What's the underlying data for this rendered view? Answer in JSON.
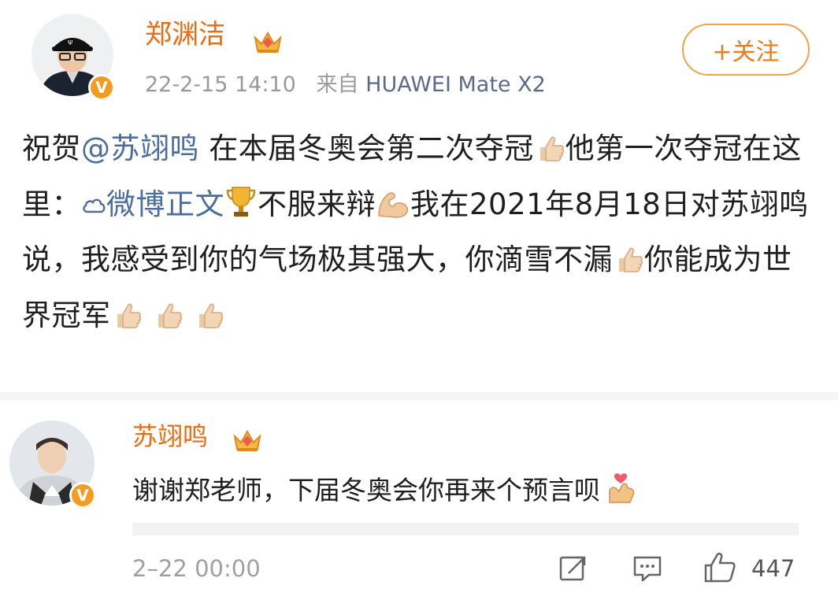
{
  "post": {
    "author": "郑渊洁",
    "timestamp": "22-2-15 14:10",
    "source_prefix": "来自",
    "device": "HUAWEI Mate X2",
    "follow_label": "+关注",
    "text_before_mention": "祝贺",
    "mention": "@苏翊鸣",
    "text_after_mention": " 在本届冬奥会第二次夺冠",
    "text_after_thumb1": "他第一次夺冠在这里：",
    "link_label": "微博正文",
    "text_after_trophy": "不服来辩",
    "text_after_muscle": "我在2021年8月18日对苏翊鸣说，我感受到你的气场极其强大，你滴雪不漏",
    "text_after_thumb2": "你能成为世界冠军",
    "emojis": [
      "thumbs-up-icon",
      "trophy-icon",
      "flexed-biceps-icon"
    ]
  },
  "comment": {
    "author": "苏翊鸣",
    "text": "谢谢郑老师，下届冬奥会你再来个预言呗",
    "emoji": "heart-hands-icon",
    "timestamp": "2–22 00:00",
    "like_count": "447"
  },
  "colors": {
    "username": "#f06a0f",
    "link": "#4a6e9f",
    "badge": "#f59b1f",
    "meta": "#9a9a9a"
  }
}
